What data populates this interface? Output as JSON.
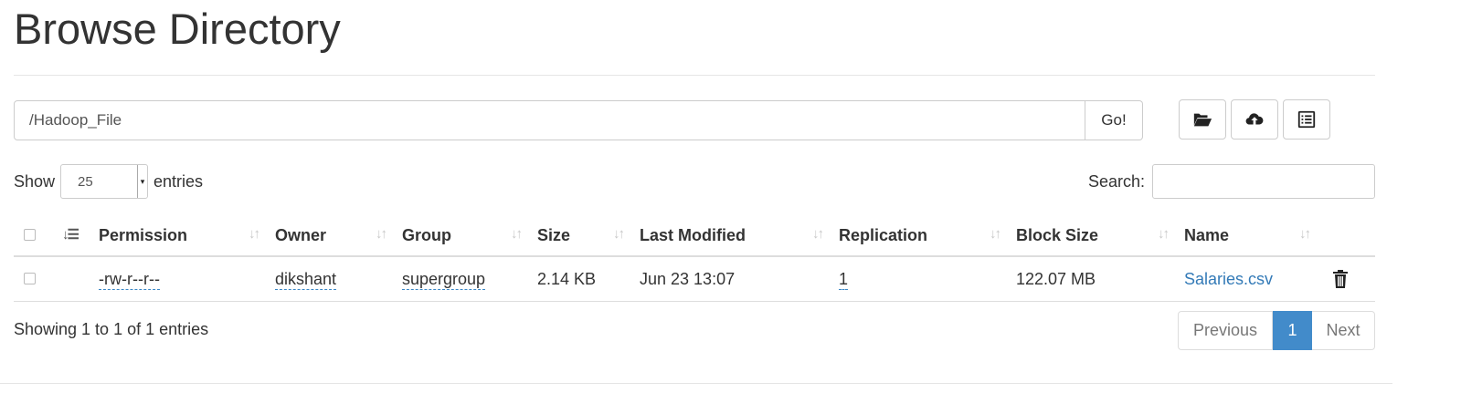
{
  "page": {
    "title": "Browse Directory"
  },
  "path": {
    "value": "/Hadoop_File",
    "go_label": "Go!"
  },
  "toolbar": {
    "icons": [
      "folder-open-icon",
      "cloud-upload-icon",
      "list-alt-icon"
    ]
  },
  "length": {
    "show_label": "Show",
    "value": "25",
    "entries_label": "entries"
  },
  "search": {
    "label": "Search:",
    "value": ""
  },
  "table": {
    "headers": [
      "Permission",
      "Owner",
      "Group",
      "Size",
      "Last Modified",
      "Replication",
      "Block Size",
      "Name"
    ],
    "rows": [
      {
        "permission": "-rw-r--r--",
        "owner": "dikshant",
        "group": "supergroup",
        "size": "2.14 KB",
        "last_modified": "Jun 23 13:07",
        "replication": "1",
        "block_size": "122.07 MB",
        "name": "Salaries.csv"
      }
    ]
  },
  "info": "Showing 1 to 1 of 1 entries",
  "pagination": {
    "previous": "Previous",
    "current": "1",
    "next": "Next"
  },
  "colors": {
    "link": "#337ab7",
    "active_page": "#428bca"
  }
}
